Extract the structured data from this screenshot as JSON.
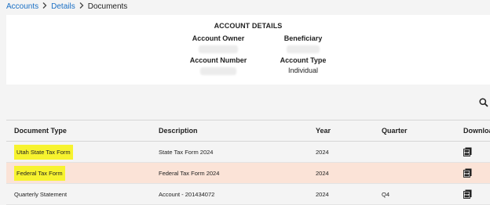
{
  "breadcrumb": {
    "items": [
      "Accounts",
      "Details"
    ],
    "current": "Documents"
  },
  "account_details": {
    "title": "ACCOUNT DETAILS",
    "owner_label": "Account Owner",
    "beneficiary_label": "Beneficiary",
    "number_label": "Account Number",
    "type_label": "Account Type",
    "type_value": "Individual"
  },
  "table": {
    "headers": [
      "Document Type",
      "Description",
      "Year",
      "Quarter",
      "Download"
    ],
    "rows": [
      {
        "type": "Utah State Tax Form",
        "description": "State Tax Form 2024",
        "year": "2024",
        "quarter": "",
        "highlighted_label": true,
        "row_highlight": false
      },
      {
        "type": "Federal Tax Form",
        "description": "Federal Tax Form 2024",
        "year": "2024",
        "quarter": "",
        "highlighted_label": true,
        "row_highlight": true
      },
      {
        "type": "Quarterly Statement",
        "description": "Account - 201434072",
        "year": "2024",
        "quarter": "Q4",
        "highlighted_label": false,
        "row_highlight": false
      }
    ]
  },
  "icons": {
    "search": "search-icon",
    "download": "pdf-download-icon",
    "separator": "chevron-right-icon"
  },
  "colors": {
    "link": "#1a6fc4",
    "highlight_mark": "#f7f32f",
    "row_highlight": "#fbe3d7"
  }
}
